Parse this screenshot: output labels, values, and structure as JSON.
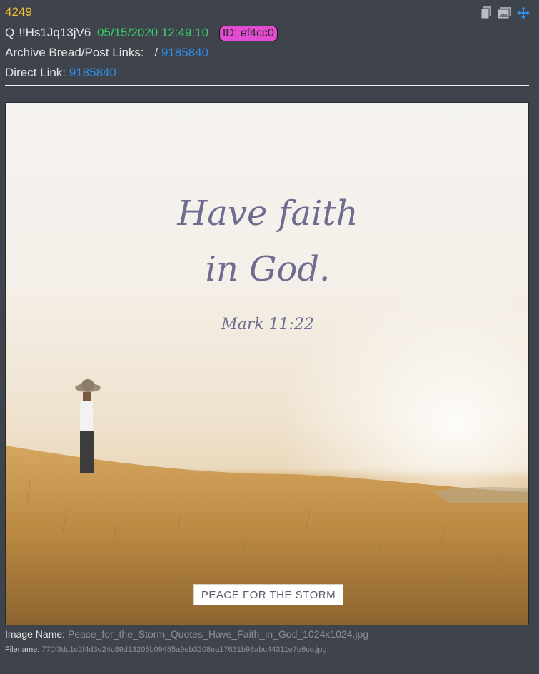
{
  "post": {
    "number": "4249",
    "author": "Q",
    "tripcode": "!!Hs1Jq13jV6",
    "datetime": "05/15/2020 12:49:10",
    "id_badge": "ID: ef4cc0",
    "archive_label": "Archive Bread/Post Links:",
    "archive_sep": "/",
    "archive_link": "9185840",
    "direct_label": "Direct Link:",
    "direct_link": "9185840"
  },
  "toolbar": {
    "icons": [
      "copy-icon",
      "image-icon",
      "move-icon"
    ]
  },
  "image": {
    "quote_line1": "Have faith",
    "quote_line2": "in God.",
    "reference": "Mark 11:22",
    "brand": "PEACE FOR THE STORM"
  },
  "meta": {
    "image_name_label": "Image Name:",
    "image_name": "Peace_for_the_Storm_Quotes_Have_Faith_in_God_1024x1024.jpg",
    "filename_label": "Filename:",
    "filename": "770f3dc1c2f4d3e24c89d13205b09485a9eb3208ea17631b98abc44311e7e6ce.jpg"
  },
  "colors": {
    "background": "#3f434b",
    "post_number": "#f2c12e",
    "datetime": "#3bd06c",
    "id_badge": "#e24cd2",
    "link": "#2f8fe8"
  }
}
